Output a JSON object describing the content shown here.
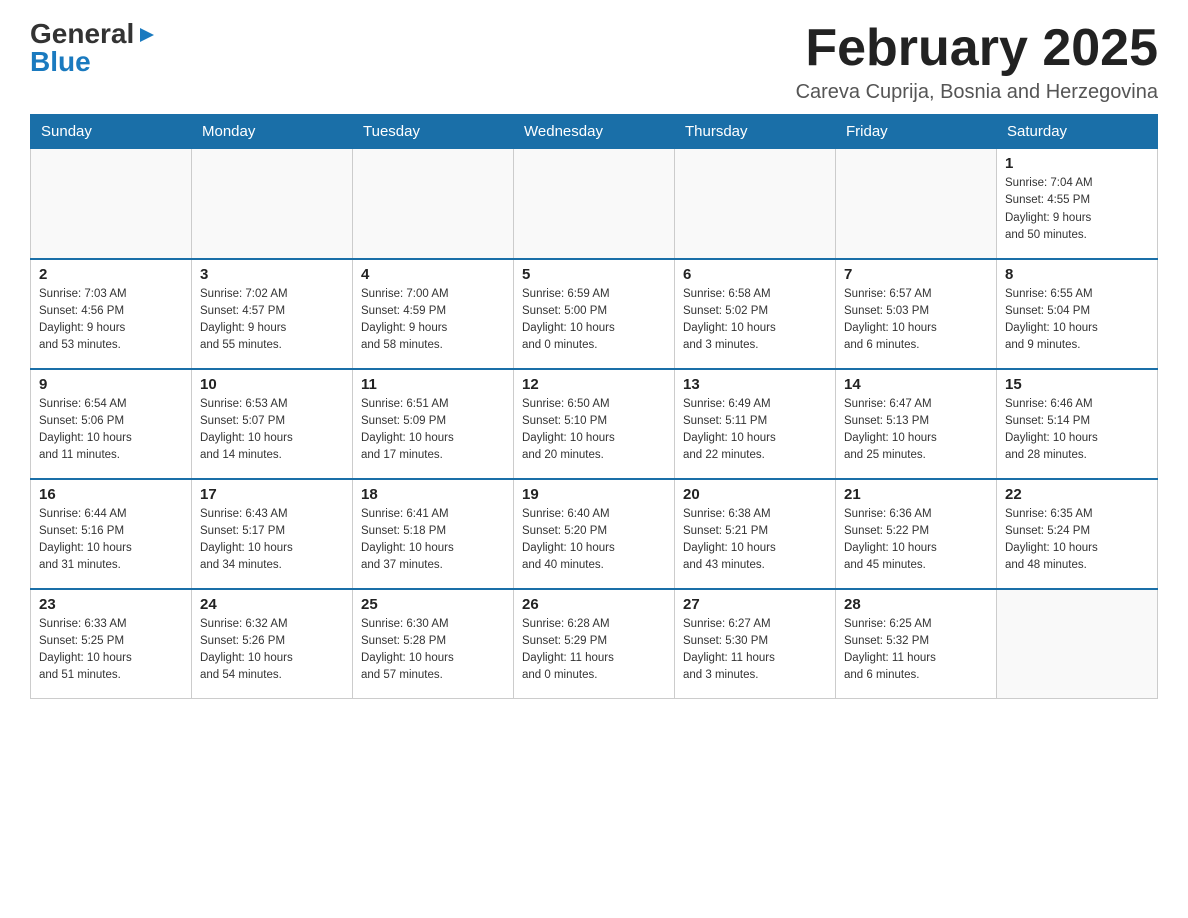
{
  "header": {
    "logo": {
      "general": "General",
      "blue": "Blue",
      "arrow": "▶"
    },
    "title": "February 2025",
    "location": "Careva Cuprija, Bosnia and Herzegovina"
  },
  "calendar": {
    "days_of_week": [
      "Sunday",
      "Monday",
      "Tuesday",
      "Wednesday",
      "Thursday",
      "Friday",
      "Saturday"
    ],
    "weeks": [
      [
        {
          "day": "",
          "info": ""
        },
        {
          "day": "",
          "info": ""
        },
        {
          "day": "",
          "info": ""
        },
        {
          "day": "",
          "info": ""
        },
        {
          "day": "",
          "info": ""
        },
        {
          "day": "",
          "info": ""
        },
        {
          "day": "1",
          "info": "Sunrise: 7:04 AM\nSunset: 4:55 PM\nDaylight: 9 hours\nand 50 minutes."
        }
      ],
      [
        {
          "day": "2",
          "info": "Sunrise: 7:03 AM\nSunset: 4:56 PM\nDaylight: 9 hours\nand 53 minutes."
        },
        {
          "day": "3",
          "info": "Sunrise: 7:02 AM\nSunset: 4:57 PM\nDaylight: 9 hours\nand 55 minutes."
        },
        {
          "day": "4",
          "info": "Sunrise: 7:00 AM\nSunset: 4:59 PM\nDaylight: 9 hours\nand 58 minutes."
        },
        {
          "day": "5",
          "info": "Sunrise: 6:59 AM\nSunset: 5:00 PM\nDaylight: 10 hours\nand 0 minutes."
        },
        {
          "day": "6",
          "info": "Sunrise: 6:58 AM\nSunset: 5:02 PM\nDaylight: 10 hours\nand 3 minutes."
        },
        {
          "day": "7",
          "info": "Sunrise: 6:57 AM\nSunset: 5:03 PM\nDaylight: 10 hours\nand 6 minutes."
        },
        {
          "day": "8",
          "info": "Sunrise: 6:55 AM\nSunset: 5:04 PM\nDaylight: 10 hours\nand 9 minutes."
        }
      ],
      [
        {
          "day": "9",
          "info": "Sunrise: 6:54 AM\nSunset: 5:06 PM\nDaylight: 10 hours\nand 11 minutes."
        },
        {
          "day": "10",
          "info": "Sunrise: 6:53 AM\nSunset: 5:07 PM\nDaylight: 10 hours\nand 14 minutes."
        },
        {
          "day": "11",
          "info": "Sunrise: 6:51 AM\nSunset: 5:09 PM\nDaylight: 10 hours\nand 17 minutes."
        },
        {
          "day": "12",
          "info": "Sunrise: 6:50 AM\nSunset: 5:10 PM\nDaylight: 10 hours\nand 20 minutes."
        },
        {
          "day": "13",
          "info": "Sunrise: 6:49 AM\nSunset: 5:11 PM\nDaylight: 10 hours\nand 22 minutes."
        },
        {
          "day": "14",
          "info": "Sunrise: 6:47 AM\nSunset: 5:13 PM\nDaylight: 10 hours\nand 25 minutes."
        },
        {
          "day": "15",
          "info": "Sunrise: 6:46 AM\nSunset: 5:14 PM\nDaylight: 10 hours\nand 28 minutes."
        }
      ],
      [
        {
          "day": "16",
          "info": "Sunrise: 6:44 AM\nSunset: 5:16 PM\nDaylight: 10 hours\nand 31 minutes."
        },
        {
          "day": "17",
          "info": "Sunrise: 6:43 AM\nSunset: 5:17 PM\nDaylight: 10 hours\nand 34 minutes."
        },
        {
          "day": "18",
          "info": "Sunrise: 6:41 AM\nSunset: 5:18 PM\nDaylight: 10 hours\nand 37 minutes."
        },
        {
          "day": "19",
          "info": "Sunrise: 6:40 AM\nSunset: 5:20 PM\nDaylight: 10 hours\nand 40 minutes."
        },
        {
          "day": "20",
          "info": "Sunrise: 6:38 AM\nSunset: 5:21 PM\nDaylight: 10 hours\nand 43 minutes."
        },
        {
          "day": "21",
          "info": "Sunrise: 6:36 AM\nSunset: 5:22 PM\nDaylight: 10 hours\nand 45 minutes."
        },
        {
          "day": "22",
          "info": "Sunrise: 6:35 AM\nSunset: 5:24 PM\nDaylight: 10 hours\nand 48 minutes."
        }
      ],
      [
        {
          "day": "23",
          "info": "Sunrise: 6:33 AM\nSunset: 5:25 PM\nDaylight: 10 hours\nand 51 minutes."
        },
        {
          "day": "24",
          "info": "Sunrise: 6:32 AM\nSunset: 5:26 PM\nDaylight: 10 hours\nand 54 minutes."
        },
        {
          "day": "25",
          "info": "Sunrise: 6:30 AM\nSunset: 5:28 PM\nDaylight: 10 hours\nand 57 minutes."
        },
        {
          "day": "26",
          "info": "Sunrise: 6:28 AM\nSunset: 5:29 PM\nDaylight: 11 hours\nand 0 minutes."
        },
        {
          "day": "27",
          "info": "Sunrise: 6:27 AM\nSunset: 5:30 PM\nDaylight: 11 hours\nand 3 minutes."
        },
        {
          "day": "28",
          "info": "Sunrise: 6:25 AM\nSunset: 5:32 PM\nDaylight: 11 hours\nand 6 minutes."
        },
        {
          "day": "",
          "info": ""
        }
      ]
    ]
  }
}
